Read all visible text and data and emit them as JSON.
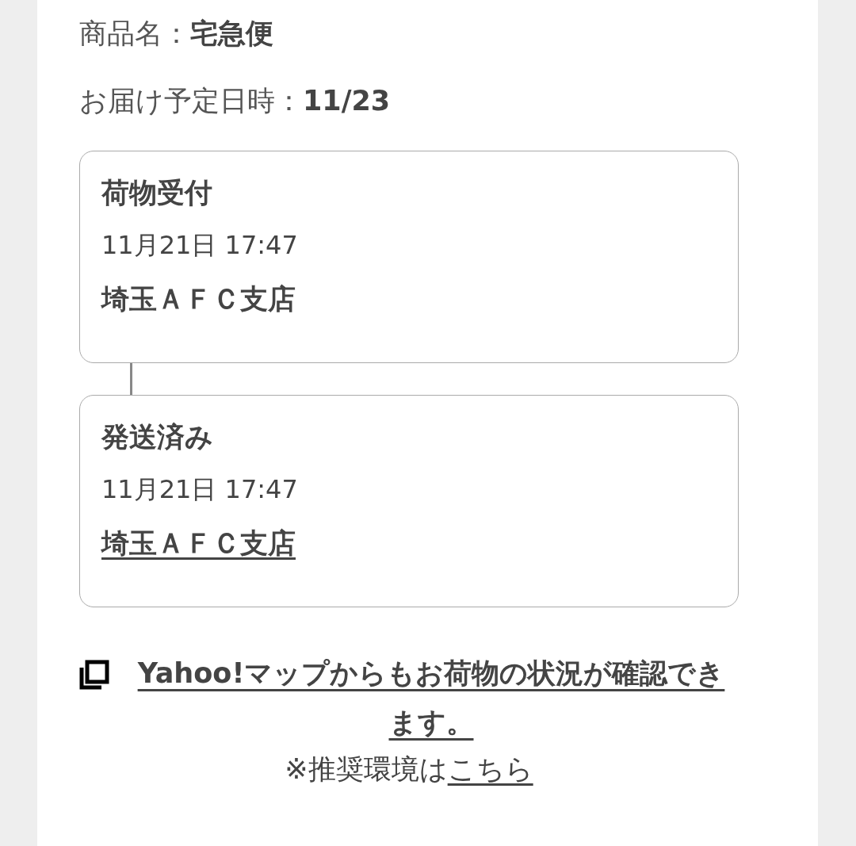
{
  "details": [
    {
      "label": "商品名：",
      "value": "宅急便"
    },
    {
      "label": "お届け予定日時：",
      "value": "11/23"
    }
  ],
  "events": [
    {
      "status": "荷物受付",
      "time": "11月21日 17:47",
      "location": "埼玉ＡＦＣ支店",
      "linked": false
    },
    {
      "status": "発送済み",
      "time": "11月21日 17:47",
      "location": "埼玉ＡＦＣ支店",
      "linked": true
    }
  ],
  "map_link": "Yahoo!マップからもお荷物の状況が確認できます。",
  "note": {
    "text": "※推奨環境は",
    "link": "こちら"
  }
}
